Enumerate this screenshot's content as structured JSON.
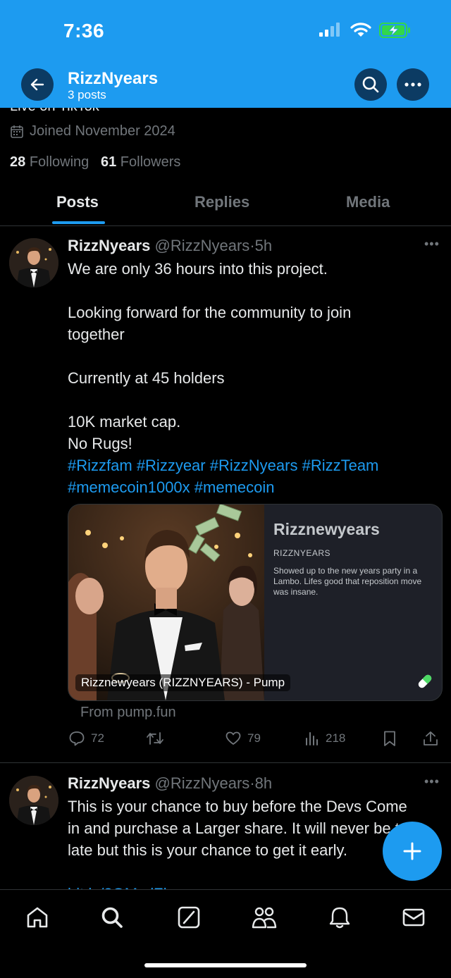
{
  "status_bar": {
    "time": "7:36"
  },
  "header": {
    "title": "RizzNyears",
    "subtitle": "3 posts",
    "peek_text": "Live on TikTok"
  },
  "profile": {
    "joined": "Joined November 2024",
    "following_count": "28",
    "following_label": "Following",
    "followers_count": "61",
    "followers_label": "Followers"
  },
  "tabs": [
    "Posts",
    "Replies",
    "Media"
  ],
  "active_tab": "Posts",
  "posts": [
    {
      "name": "RizzNyears",
      "handle": "@RizzNyears",
      "sep": "·",
      "time": "5h",
      "lines": [
        "We are only 36 hours into this project.",
        "",
        "Looking forward for the community to join",
        "together",
        "",
        "Currently at 45 holders",
        "",
        "10K market cap.",
        "No Rugs!"
      ],
      "hashtags_line1": [
        "#Rizzfam",
        "#Rizzyear",
        "#RizzNyears",
        "#RizzTeam"
      ],
      "hashtags_line2": [
        "#memecoin1000x",
        "#memecoin"
      ],
      "card": {
        "title": "Rizznewyears",
        "symbol": "RIZZNYEARS",
        "description": "Showed up to the new years party in a Lambo. Lifes good that reposition move was insane.",
        "image_caption": "Rizznewyears (RIZZNYEARS) - Pump",
        "source": "From pump.fun"
      },
      "actions": {
        "replies": "72",
        "reposts": "",
        "likes": "79",
        "views": "218"
      }
    },
    {
      "name": "RizzNyears",
      "handle": "@RizzNyears",
      "sep": "·",
      "time": "8h",
      "lines": [
        "This is your chance to buy before the Devs Come",
        "in and purchase a Larger share.  It will never be too",
        "late but this is your chance to get it early."
      ],
      "link_peek": "bit.ly/3OMsdZl"
    }
  ],
  "colors": {
    "accent": "#1d9bf0",
    "background": "#000000",
    "text": "#e7e9ea",
    "muted": "#71767b",
    "card_bg": "#1e2028"
  },
  "icons": {
    "header": [
      "back-arrow-icon",
      "search-icon",
      "more-icon"
    ],
    "nav": [
      "home-icon",
      "search-icon",
      "grok-icon",
      "communities-icon",
      "notifications-icon",
      "messages-icon"
    ],
    "fab": "plus-icon"
  }
}
